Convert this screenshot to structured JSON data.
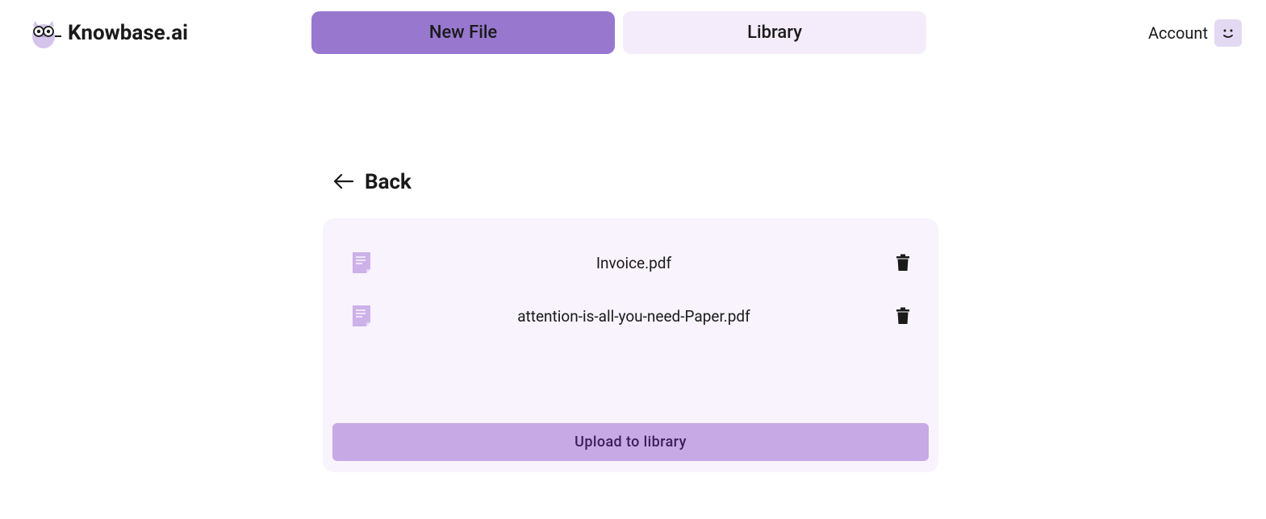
{
  "brand": {
    "name": "Knowbase.ai"
  },
  "nav": {
    "tabs": [
      {
        "label": "New File",
        "active": true
      },
      {
        "label": "Library",
        "active": false
      }
    ]
  },
  "account": {
    "label": "Account"
  },
  "back": {
    "label": "Back"
  },
  "files": [
    {
      "name": "Invoice.pdf"
    },
    {
      "name": "attention-is-all-you-need-Paper.pdf"
    }
  ],
  "upload": {
    "label": "Upload to library"
  }
}
